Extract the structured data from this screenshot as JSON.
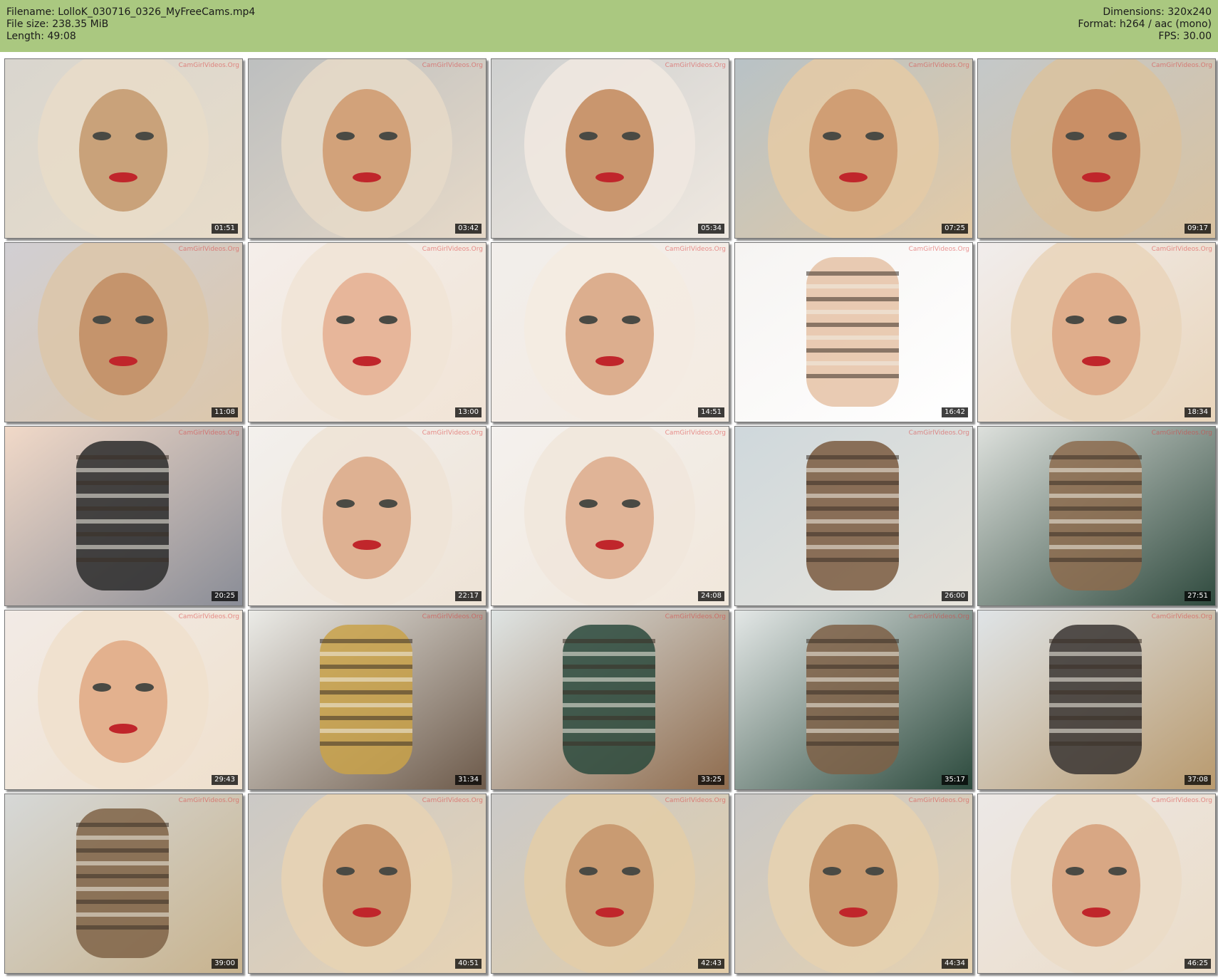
{
  "header": {
    "filename": "Filename: LolloK_030716_0326_MyFreeCams.mp4",
    "filesize": "File size: 238.35 MiB",
    "length": "Length: 49:08",
    "dimensions": "Dimensions: 320x240",
    "format": "Format: h264 / aac (mono)",
    "fps": "FPS: 30.00",
    "background_color": "#aac880"
  },
  "watermark": "CamGirlVideos.Org",
  "thumbnails": [
    {
      "time": "01:51",
      "scene": "face-blonde-office",
      "colors": [
        "#d9d6cf",
        "#c9a27a",
        "#e8dcc9"
      ]
    },
    {
      "time": "03:42",
      "scene": "face-closeup",
      "colors": [
        "#bdbfbf",
        "#d2a27a",
        "#e6d9c8"
      ]
    },
    {
      "time": "05:34",
      "scene": "face-hands-collar",
      "colors": [
        "#cfd0cf",
        "#c9966e",
        "#efe8e0"
      ]
    },
    {
      "time": "07:25",
      "scene": "face-closeup-door",
      "colors": [
        "#b8c2c6",
        "#d09e74",
        "#e3caa6"
      ]
    },
    {
      "time": "09:17",
      "scene": "face-smile",
      "colors": [
        "#c4c8c9",
        "#c98f66",
        "#d9c2a0"
      ]
    },
    {
      "time": "11:08",
      "scene": "face-tilted",
      "colors": [
        "#d1cfd3",
        "#c5946c",
        "#dcc7ab"
      ]
    },
    {
      "time": "13:00",
      "scene": "face-bright-smile",
      "colors": [
        "#f4eeea",
        "#e7b69a",
        "#f1e4d6"
      ]
    },
    {
      "time": "14:51",
      "scene": "face-bright-blonde",
      "colors": [
        "#f2eeeb",
        "#dcae8e",
        "#f4ebe1"
      ]
    },
    {
      "time": "16:42",
      "scene": "chest-white-shirt",
      "colors": [
        "#f6f4f2",
        "#e5c2a6",
        "#ffffff"
      ]
    },
    {
      "time": "18:34",
      "scene": "face-side-glance",
      "colors": [
        "#f1edec",
        "#dfae8c",
        "#e9d5bb"
      ]
    },
    {
      "time": "20:25",
      "scene": "dark-closeup",
      "colors": [
        "#f1d9c8",
        "#2b2b2b",
        "#8a8d97"
      ]
    },
    {
      "time": "22:17",
      "scene": "face-smile-bright",
      "colors": [
        "#f3f0ed",
        "#deb192",
        "#eee3d6"
      ]
    },
    {
      "time": "24:08",
      "scene": "face-lips-bright",
      "colors": [
        "#f4f1ee",
        "#e0b497",
        "#f1e7db"
      ]
    },
    {
      "time": "26:00",
      "scene": "patterned-skirt-shelf",
      "colors": [
        "#cfd8dc",
        "#7a5b40",
        "#e8e4dc"
      ]
    },
    {
      "time": "27:51",
      "scene": "patterned-skirt-board",
      "colors": [
        "#dde0dc",
        "#8c6b4d",
        "#2f4a3e"
      ]
    },
    {
      "time": "29:43",
      "scene": "face-closeup-earring",
      "colors": [
        "#f2ebe6",
        "#e3b18e",
        "#efe0cd"
      ]
    },
    {
      "time": "31:34",
      "scene": "patterned-skirt-bright",
      "colors": [
        "#ebebe7",
        "#c9a24a",
        "#6d5a4a"
      ]
    },
    {
      "time": "33:25",
      "scene": "standing-board",
      "colors": [
        "#dfe4e3",
        "#2c4a3d",
        "#8f6c4e"
      ]
    },
    {
      "time": "35:17",
      "scene": "standing-window",
      "colors": [
        "#e3e7e6",
        "#7e6047",
        "#2c4a3d"
      ]
    },
    {
      "time": "37:08",
      "scene": "legs-stockings",
      "colors": [
        "#dfe4e7",
        "#3a3533",
        "#b99a6e"
      ]
    },
    {
      "time": "39:00",
      "scene": "skirt-drawer",
      "colors": [
        "#d6d8d7",
        "#7f6346",
        "#c8b38e"
      ]
    },
    {
      "time": "40:51",
      "scene": "face-office",
      "colors": [
        "#cbc9c6",
        "#c8976e",
        "#e7d3b4"
      ]
    },
    {
      "time": "42:43",
      "scene": "face-office-2",
      "colors": [
        "#cbcac8",
        "#c99b72",
        "#e2cda9"
      ]
    },
    {
      "time": "44:34",
      "scene": "face-office-3",
      "colors": [
        "#c9c8c6",
        "#c8996f",
        "#e5d1b0"
      ]
    },
    {
      "time": "46:25",
      "scene": "face-hair-toss",
      "colors": [
        "#ece8e6",
        "#d8a784",
        "#ebdcc7"
      ]
    }
  ]
}
